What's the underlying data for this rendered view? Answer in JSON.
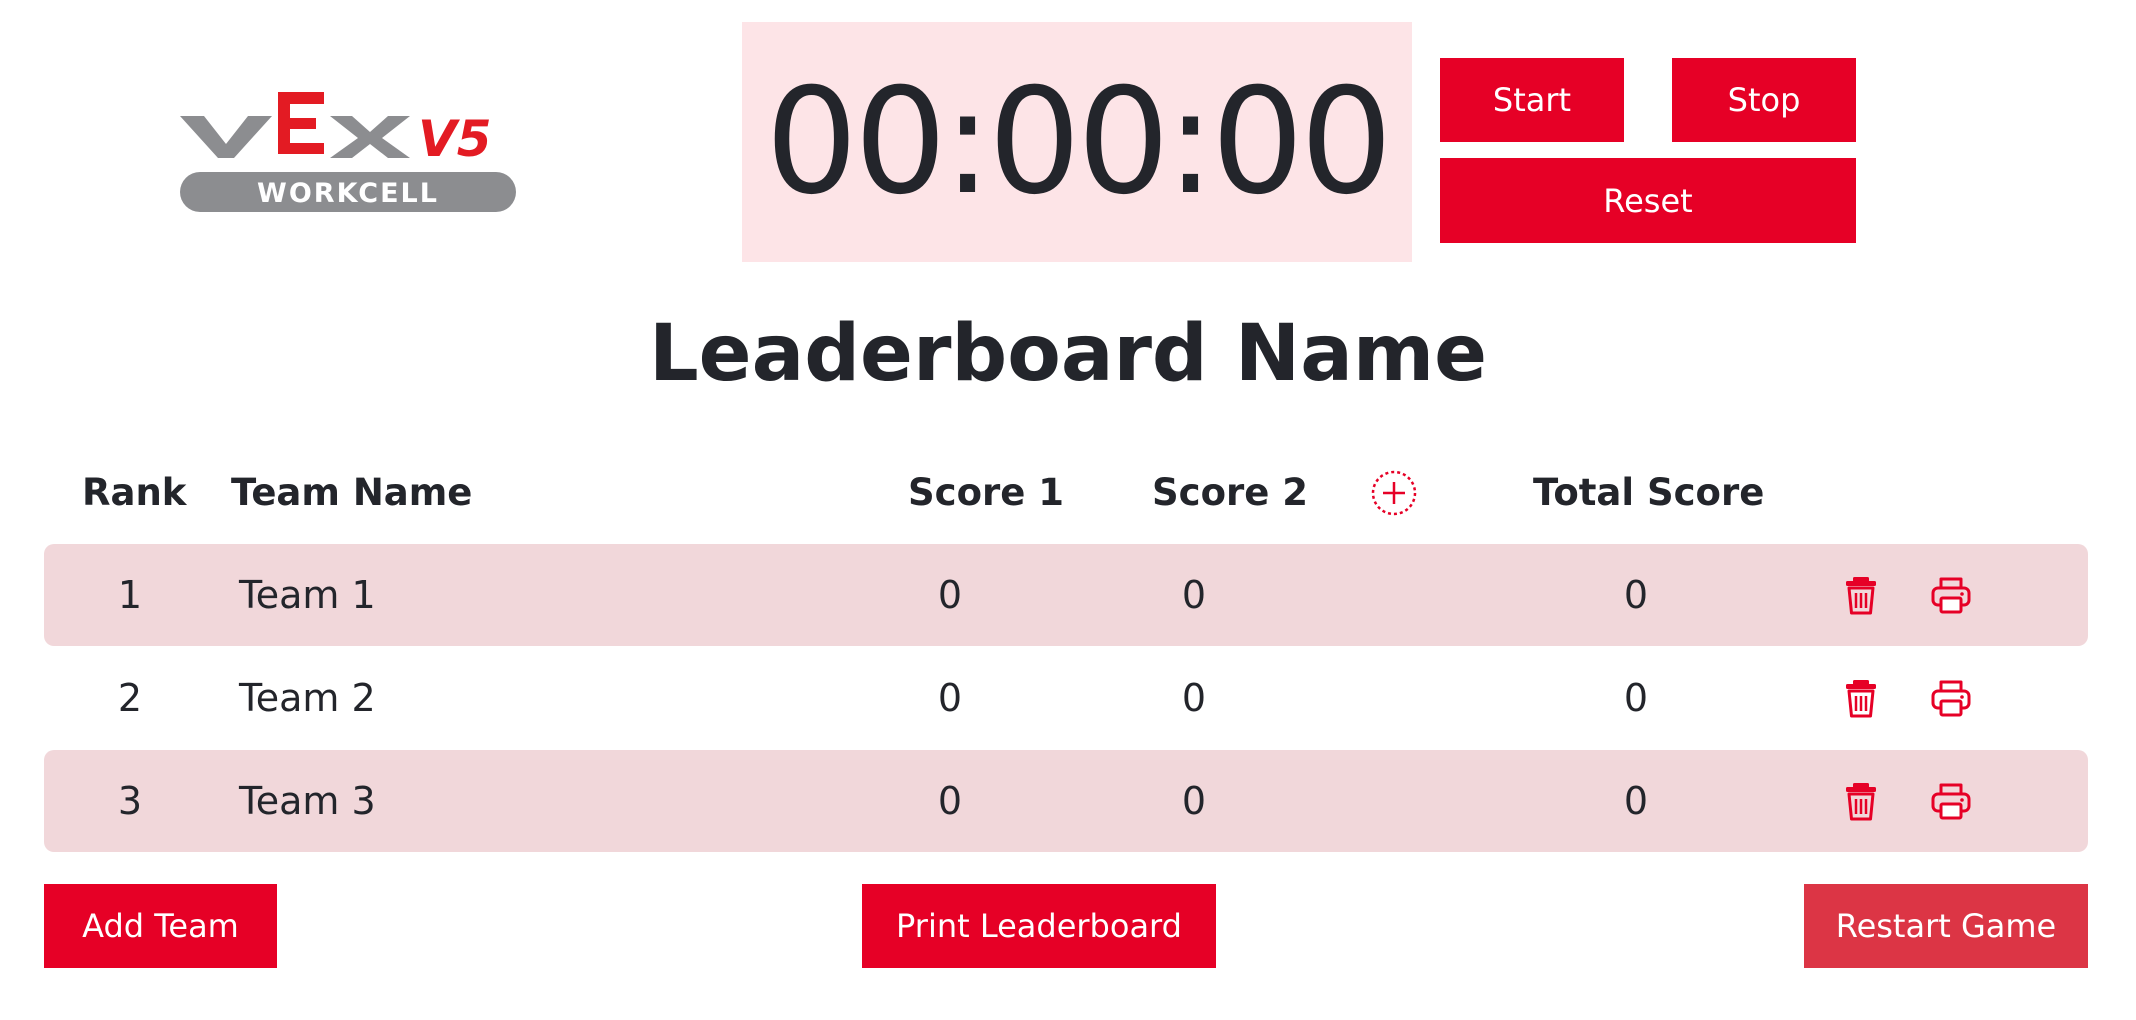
{
  "logo": {
    "brand": "VEX",
    "model": "V5",
    "product": "WORKCELL"
  },
  "timer": {
    "display": "00:00:00",
    "start_label": "Start",
    "stop_label": "Stop",
    "reset_label": "Reset"
  },
  "leaderboard": {
    "title": "Leaderboard Name",
    "columns": {
      "rank": "Rank",
      "team": "Team Name",
      "score1": "Score 1",
      "score2": "Score 2",
      "total": "Total Score"
    },
    "add_column_icon": "plus-circle-icon",
    "rows": [
      {
        "rank": "1",
        "team": "Team 1",
        "score1": "0",
        "score2": "0",
        "total": "0"
      },
      {
        "rank": "2",
        "team": "Team 2",
        "score1": "0",
        "score2": "0",
        "total": "0"
      },
      {
        "rank": "3",
        "team": "Team 3",
        "score1": "0",
        "score2": "0",
        "total": "0"
      }
    ],
    "row_icons": [
      "trash-icon",
      "printer-icon"
    ]
  },
  "footer": {
    "add_team_label": "Add Team",
    "print_label": "Print Leaderboard",
    "restart_label": "Restart Game"
  },
  "colors": {
    "accent": "#e60026",
    "restart": "#dc3545",
    "timer_bg": "#fde4e7",
    "row_shade": "#f1d7da",
    "text": "#23252b",
    "logo_gray": "#8c8d90"
  }
}
